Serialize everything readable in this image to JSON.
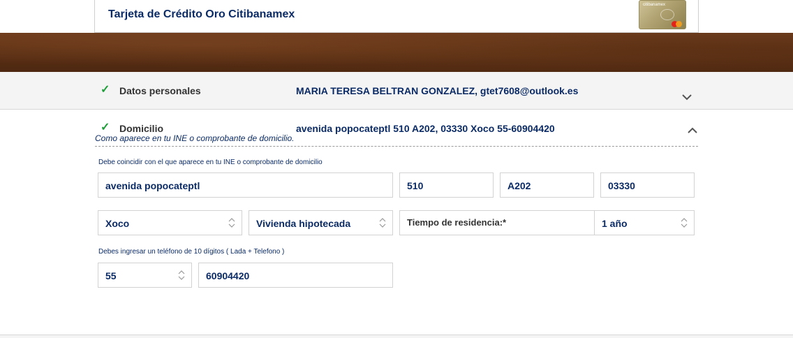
{
  "header": {
    "title": "Tarjeta de Crédito Oro Citibanamex",
    "card_brand": "citibanamex"
  },
  "sections": {
    "personal": {
      "label": "Datos personales",
      "summary": "MARIA TERESA BELTRAN GONZALEZ, gtet7608@outlook.es",
      "status": "complete",
      "expanded": false
    },
    "address": {
      "label": "Domicilio",
      "summary": "avenida popocateptl 510 A202, 03330 Xoco 55-60904420",
      "note": "Como aparece en tu INE o comprobante de domicilio.",
      "status": "complete",
      "expanded": true
    }
  },
  "form": {
    "address_hint": "Debe coincidir con el que aparece en tu INE o comprobante de domicilio",
    "street": "avenida popocateptl",
    "ext_number": "510",
    "int_number": "A202",
    "postal_code": "03330",
    "colonia": "Xoco",
    "housing_type": "Vivienda hipotecada",
    "residence_time_label": "Tiempo de residencia:*",
    "residence_time": "1 año",
    "phone_hint": "Debes ingresar un teléfono de 10 dígitos ( Lada + Telefono )",
    "phone_lada": "55",
    "phone_number": "60904420"
  },
  "colors": {
    "primary_text": "#0b2b66",
    "check_green": "#1f9e3a",
    "banner_brown": "#5a2f14"
  }
}
